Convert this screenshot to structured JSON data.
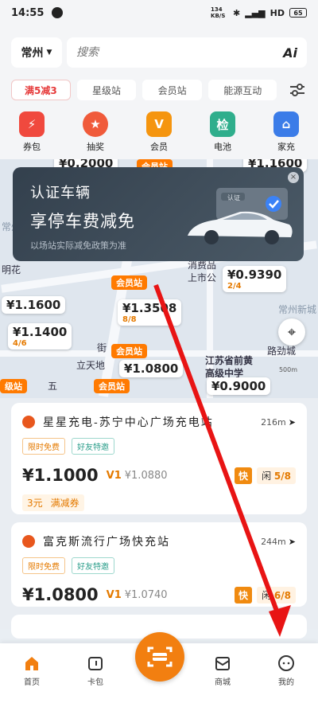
{
  "status_bar": {
    "time": "14:55",
    "net_speed": "134 KB/S",
    "signal": "HD",
    "battery": "65"
  },
  "header": {
    "city": "常州",
    "search_placeholder": "搜索",
    "ai_label": "Ai",
    "promo_chip": "满5减3",
    "chips": [
      "星级站",
      "会员站",
      "能源互动"
    ]
  },
  "quick_actions": [
    {
      "label": "券包",
      "color": "#f0493e",
      "icon": "coupon-wallet-icon"
    },
    {
      "label": "抽奖",
      "color": "#f05a3a",
      "icon": "lottery-medal-icon"
    },
    {
      "label": "会员",
      "color": "#f5950f",
      "icon": "member-v-icon"
    },
    {
      "label": "电池",
      "color": "#2fae8c",
      "icon": "battery-check-icon"
    },
    {
      "label": "家充",
      "color": "#3b7ce8",
      "icon": "home-charger-icon"
    }
  ],
  "banner": {
    "title1": "认证车辆",
    "title2": "享停车费减免",
    "subtitle": "以场站实际减免政策为准",
    "cert_label": "认证"
  },
  "map": {
    "pins": [
      {
        "price": "¥0.2000"
      },
      {
        "price": "¥1.1600"
      },
      {
        "price": "¥0.9390",
        "avail": "2/4"
      },
      {
        "price": "¥1.1600"
      },
      {
        "price": "¥1.1400",
        "avail": "4/6"
      },
      {
        "price": "¥1.3508",
        "avail": "8/8"
      },
      {
        "price": "¥1.0800"
      },
      {
        "price": "¥0.9000"
      }
    ],
    "vip_label": "会员站",
    "labels": [
      "消费品",
      "上市公",
      "明花",
      "街",
      "立天地",
      "江苏省前黄",
      "高级中学",
      "路劲城",
      "常州新城",
      "常州",
      "五",
      "级站"
    ],
    "scale": "500m"
  },
  "stations": [
    {
      "name": "星星充电-苏宁中心广场充电站",
      "distance": "216m",
      "tags": [
        "限时免费",
        "好友特邀"
      ],
      "price": "¥1.1000",
      "vip_label": "V1",
      "vip_price": "¥1.0880",
      "fast_label": "快",
      "avail_prefix": "闲",
      "avail": "5/8",
      "coupon_amount": "3元",
      "coupon_text": "满减券"
    },
    {
      "name": "富克斯流行广场快充站",
      "distance": "244m",
      "tags": [
        "限时免费",
        "好友特邀"
      ],
      "price": "¥1.0800",
      "vip_label": "V1",
      "vip_price": "¥1.0740",
      "fast_label": "快",
      "avail_prefix": "闲",
      "avail": "6/8"
    }
  ],
  "bottom_nav": [
    {
      "label": "首页",
      "icon": "home-icon"
    },
    {
      "label": "卡包",
      "icon": "wallet-icon"
    },
    {
      "label": "商城",
      "icon": "mall-icon"
    },
    {
      "label": "我的",
      "icon": "profile-icon"
    }
  ]
}
